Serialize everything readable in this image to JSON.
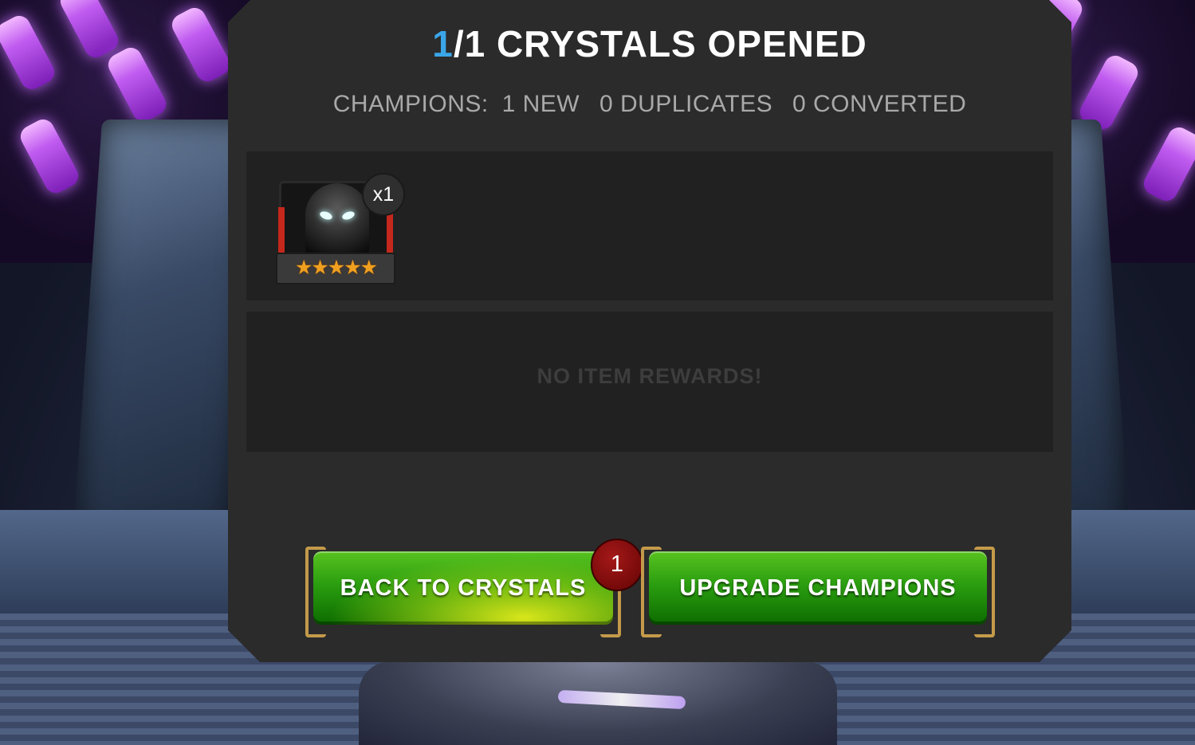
{
  "dialog": {
    "title_count": "1",
    "title_rest": "/1 CRYSTALS OPENED",
    "summary": {
      "champions_label": "CHAMPIONS:",
      "new": "1 NEW",
      "duplicates": "0 DUPLICATES",
      "converted": "0 CONVERTED"
    },
    "champions": [
      {
        "quantity": "x1",
        "stars": "★★★★★",
        "star_count": 5,
        "icon": "spider-man-stealth-suit-portrait"
      }
    ],
    "items_message": "NO ITEM REWARDS!"
  },
  "buttons": {
    "back": "BACK TO CRYSTALS",
    "back_badge": "1",
    "upgrade": "UPGRADE CHAMPIONS"
  },
  "colors": {
    "accent_blue": "#3aa6e8",
    "button_green": "#2b9e10",
    "badge_red": "#a41818",
    "panel": "#2b2b2b",
    "crystal_glow": "#c05cf0"
  }
}
